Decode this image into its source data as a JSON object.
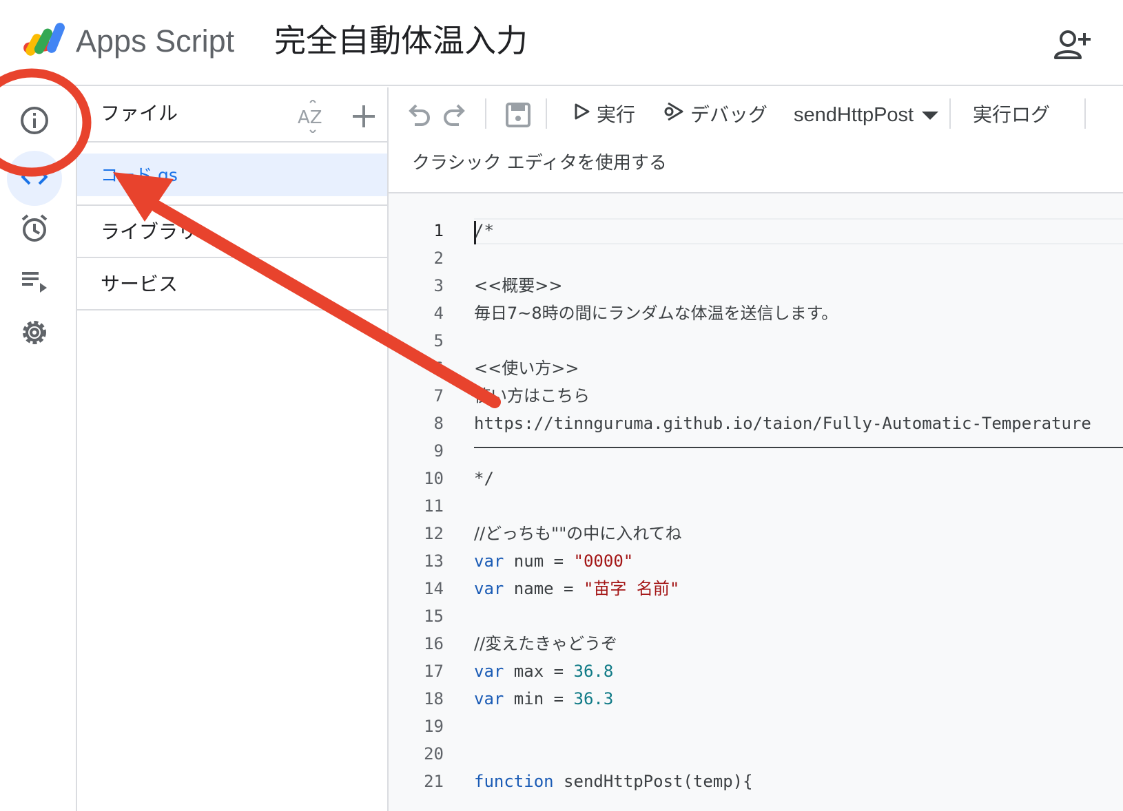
{
  "header": {
    "brand": "Apps Script",
    "project_title": "完全自動体温入力"
  },
  "rail": {
    "items": [
      {
        "icon": "info-icon"
      },
      {
        "icon": "code-icon",
        "active": true
      },
      {
        "icon": "alarm-clock-icon"
      },
      {
        "icon": "playlist-play-icon"
      },
      {
        "icon": "gear-icon"
      }
    ]
  },
  "files": {
    "title": "ファイル",
    "sort_label": "AZ",
    "file_name": "コード.gs",
    "sections": [
      "ライブラリ",
      "サービス"
    ]
  },
  "toolbar": {
    "run_label": "実行",
    "debug_label": "デバッグ",
    "function_select": "sendHttpPost",
    "log_label": "実行ログ",
    "classic_link": "クラシック エディタを使用する"
  },
  "editor": {
    "current_line": 1,
    "lines": [
      [
        {
          "t": "/*",
          "c": "plain"
        }
      ],
      [],
      [
        {
          "t": "<<概要>>",
          "c": "jp"
        }
      ],
      [
        {
          "t": "毎日7~8時の間にランダムな体温を送信します。",
          "c": "jp"
        }
      ],
      [],
      [
        {
          "t": "<<使い方>>",
          "c": "jp"
        }
      ],
      [
        {
          "t": "使い方はこちら",
          "c": "jp"
        }
      ],
      [
        {
          "t": "https://tinnguruma.github.io/taion/Fully-Automatic-Temperature",
          "c": "plain"
        }
      ],
      [],
      [
        {
          "t": "*/",
          "c": "plain"
        }
      ],
      [],
      [
        {
          "t": "//どっちも\"\"の中に入れてね",
          "c": "jp"
        }
      ],
      [
        {
          "t": "var",
          "c": "kw"
        },
        {
          "t": " num = ",
          "c": "plain"
        },
        {
          "t": "\"0000\"",
          "c": "str"
        }
      ],
      [
        {
          "t": "var",
          "c": "kw"
        },
        {
          "t": " name = ",
          "c": "plain"
        },
        {
          "t": "\"苗字 名前\"",
          "c": "str"
        }
      ],
      [],
      [
        {
          "t": "//変えたきゃどうぞ",
          "c": "jp"
        }
      ],
      [
        {
          "t": "var",
          "c": "kw"
        },
        {
          "t": " max = ",
          "c": "plain"
        },
        {
          "t": "36.8",
          "c": "num"
        }
      ],
      [
        {
          "t": "var",
          "c": "kw"
        },
        {
          "t": " min = ",
          "c": "plain"
        },
        {
          "t": "36.3",
          "c": "num"
        }
      ],
      [],
      [],
      [
        {
          "t": "function",
          "c": "kw"
        },
        {
          "t": " sendHttpPost(temp){",
          "c": "plain"
        }
      ]
    ]
  },
  "annotation": {
    "color": "#e8432d"
  }
}
